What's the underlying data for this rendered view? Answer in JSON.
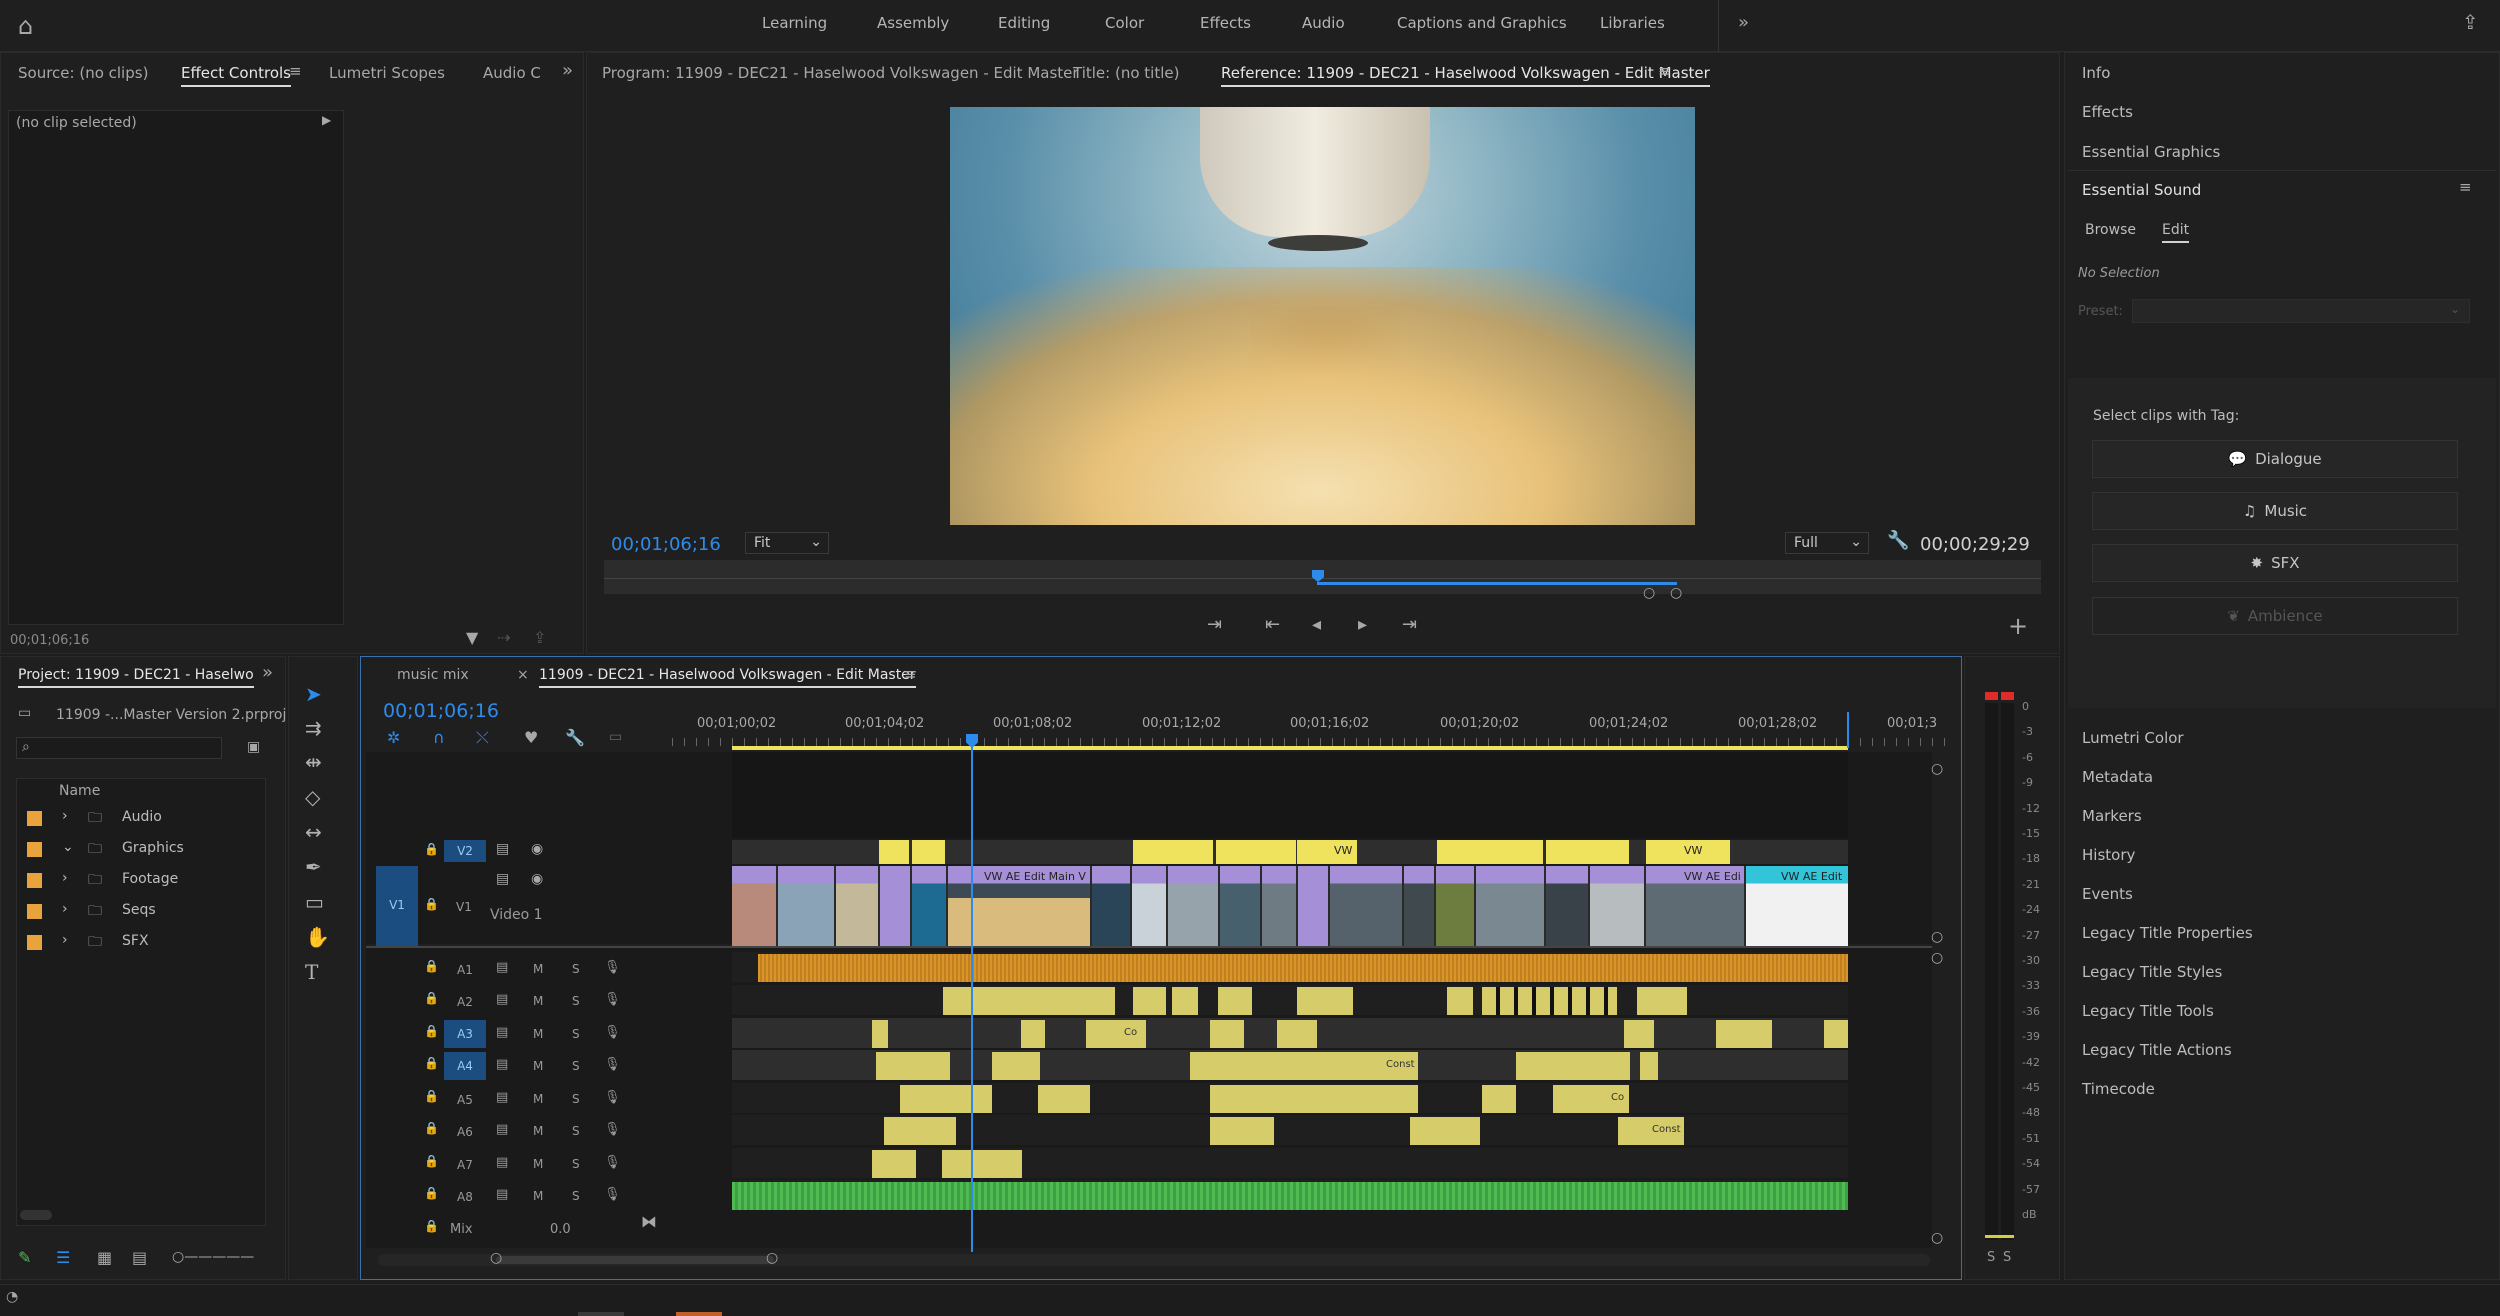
{
  "workspaces": [
    "Learning",
    "Assembly",
    "Editing",
    "Color",
    "Effects",
    "Audio",
    "Captions and Graphics",
    "Libraries"
  ],
  "left_tabs": {
    "source": "Source: (no clips)",
    "effect_controls": "Effect Controls",
    "lumetri_scopes": "Lumetri Scopes",
    "audio": "Audio C"
  },
  "effect_controls": {
    "no_clip": "(no clip selected)",
    "timecode": "00;01;06;16"
  },
  "monitor": {
    "program_tab": "Program: 11909 - DEC21 - Haselwood Volkswagen - Edit Master",
    "title_tab": "Title: (no title)",
    "reference_tab": "Reference: 11909 - DEC21 - Haselwood Volkswagen - Edit Master",
    "timecode": "00;01;06;16",
    "fit": "Fit",
    "quality": "Full",
    "duration": "00;00;29;29"
  },
  "project": {
    "tab": "Project: 11909 - DEC21 - Haselwo",
    "file": "11909 -...Master Version 2.prproj",
    "name_col": "Name",
    "bins": [
      "Audio",
      "Graphics",
      "Footage",
      "Seqs",
      "SFX"
    ]
  },
  "timeline": {
    "tab_music": "music mix",
    "tab_main": "11909 - DEC21 - Haselwood Volkswagen - Edit Master",
    "timecode": "00;01;06;16",
    "ruler": [
      "00;01;00;02",
      "00;01;04;02",
      "00;01;08;02",
      "00;01;12;02",
      "00;01;16;02",
      "00;01;20;02",
      "00;01;24;02",
      "00;01;28;02",
      "00;01;3"
    ],
    "v2": "V2",
    "v1": "V1",
    "v1_patch": "V1",
    "video1": "Video 1",
    "audio_tracks": [
      "A1",
      "A2",
      "A3",
      "A4",
      "A5",
      "A6",
      "A7",
      "A8"
    ],
    "m": "M",
    "s": "S",
    "mix": "Mix",
    "mix_val": "0.0",
    "clip_labels": {
      "vw": "VW",
      "vw_edit_main": "VW AE Edit Main V",
      "vw_edi": "VW AE Edi",
      "vw_edit": "VW AE Edit",
      "const": "Const",
      "co": "Co"
    }
  },
  "right_panel": {
    "info": "Info",
    "effects": "Effects",
    "essential_graphics": "Essential Graphics",
    "essential_sound": "Essential Sound",
    "browse": "Browse",
    "edit": "Edit",
    "no_selection": "No Selection",
    "preset": "Preset:",
    "select_clips": "Select clips with Tag:",
    "tags": [
      "Dialogue",
      "Music",
      "SFX",
      "Ambience"
    ],
    "lower": [
      "Lumetri Color",
      "Metadata",
      "Markers",
      "History",
      "Events",
      "Legacy Title Properties",
      "Legacy Title Styles",
      "Legacy Title Tools",
      "Legacy Title Actions",
      "Timecode"
    ]
  },
  "meter": {
    "scale": [
      "0",
      "-3",
      "-6",
      "-9",
      "-12",
      "-15",
      "-18",
      "-21",
      "-24",
      "-27",
      "-30",
      "-33",
      "-36",
      "-39",
      "-42",
      "-45",
      "-48",
      "-51",
      "-54",
      "-57",
      "dB"
    ],
    "s1": "S",
    "s2": "S"
  },
  "colors": {
    "accent": "#2d8ceb",
    "video_clip": "#a58fd6",
    "title_clip": "#efe25c",
    "audio_orange": "#d8962a",
    "audio_yellow": "#d6cd6a",
    "audio_green": "#4fbb52"
  }
}
